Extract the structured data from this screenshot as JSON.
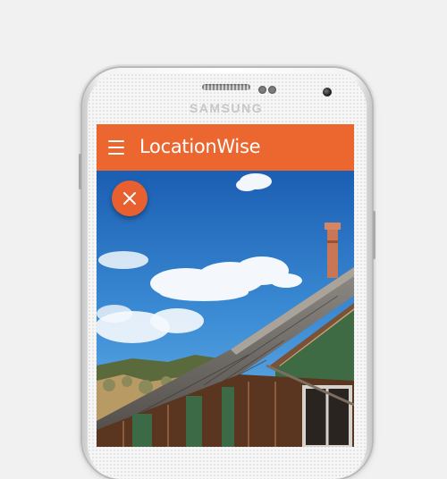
{
  "device": {
    "brand": "SAMSUNG"
  },
  "app": {
    "title": "LocationWise",
    "accent_color": "#ec6630",
    "menu_icon": "hamburger-menu-icon",
    "close_icon": "close-icon"
  }
}
